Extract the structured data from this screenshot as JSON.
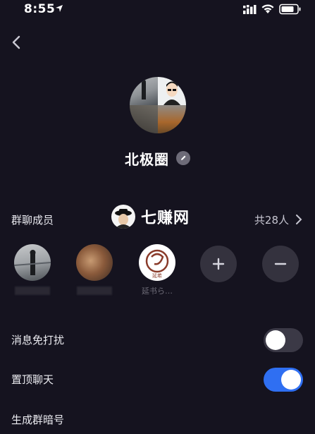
{
  "status_bar": {
    "time": "8:55"
  },
  "group": {
    "name": "北极圈"
  },
  "watermark": {
    "text": "七赚网"
  },
  "members": {
    "title": "群聊成员",
    "count_label": "共28人",
    "list": [
      {
        "name": ""
      },
      {
        "name": ""
      },
      {
        "name": "延书ら…",
        "badge_text": "延希"
      }
    ]
  },
  "settings": {
    "do_not_disturb": {
      "label": "消息免打扰",
      "enabled": false
    },
    "pin_chat": {
      "label": "置顶聊天",
      "enabled": true
    },
    "group_code": {
      "label": "生成群暗号"
    }
  },
  "colors": {
    "background": "#15131f",
    "toggle_on": "#2f6ff2",
    "toggle_off": "#3b3946"
  }
}
